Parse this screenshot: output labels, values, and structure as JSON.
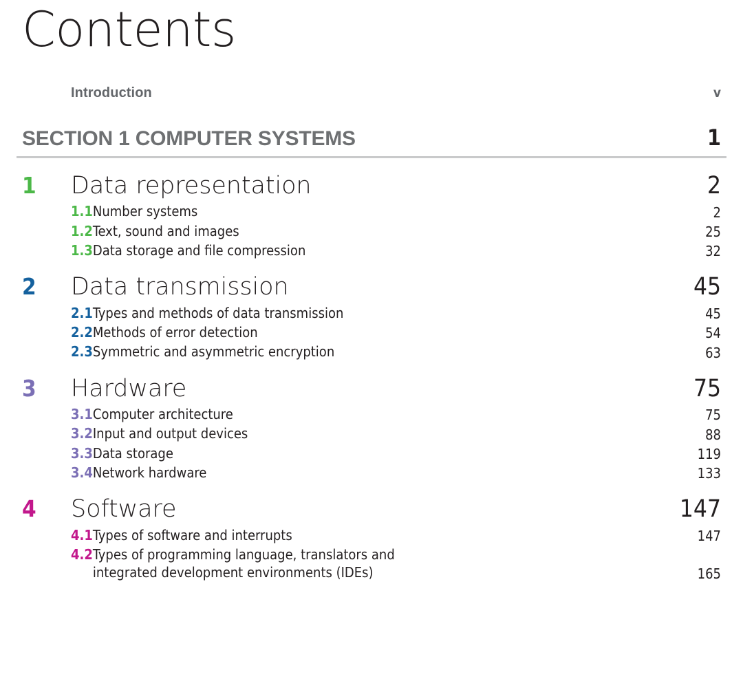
{
  "page_title": "Contents",
  "colors": {
    "text": "#231f20",
    "muted": "#63666a",
    "section_gray": "#6e7072",
    "rule": "#c9cacb",
    "chapter1_green": "#4cb848",
    "chapter2_blue": "#14619e",
    "chapter3_purple": "#7b6fb5",
    "chapter4_magenta": "#c2188c"
  },
  "frontmatter": [
    {
      "label": "Introduction",
      "page": "v"
    }
  ],
  "section": {
    "label": "SECTION 1 COMPUTER SYSTEMS",
    "page": "1"
  },
  "chapters": [
    {
      "number": "1",
      "title": "Data representation",
      "page": "2",
      "accent": "#4cb848",
      "subsections": [
        {
          "number": "1.1",
          "title": "Number systems",
          "page": "2"
        },
        {
          "number": "1.2",
          "title": "Text, sound and images",
          "page": "25"
        },
        {
          "number": "1.3",
          "title": "Data storage and file compression",
          "page": "32"
        }
      ]
    },
    {
      "number": "2",
      "title": "Data transmission",
      "page": "45",
      "accent": "#14619e",
      "subsections": [
        {
          "number": "2.1",
          "title": "Types and methods of data transmission",
          "page": "45"
        },
        {
          "number": "2.2",
          "title": "Methods of error detection",
          "page": "54"
        },
        {
          "number": "2.3",
          "title": "Symmetric and asymmetric encryption",
          "page": "63"
        }
      ]
    },
    {
      "number": "3",
      "title": "Hardware",
      "page": "75",
      "accent": "#7b6fb5",
      "subsections": [
        {
          "number": "3.1",
          "title": "Computer architecture",
          "page": "75"
        },
        {
          "number": "3.2",
          "title": "Input and output devices",
          "page": "88"
        },
        {
          "number": "3.3",
          "title": "Data storage",
          "page": "119"
        },
        {
          "number": "3.4",
          "title": "Network hardware",
          "page": "133"
        }
      ]
    },
    {
      "number": "4",
      "title": "Software",
      "page": "147",
      "accent": "#c2188c",
      "subsections": [
        {
          "number": "4.1",
          "title": "Types of software and interrupts",
          "page": "147"
        },
        {
          "number": "4.2",
          "title": "Types of programming language, translators and",
          "title_line2": "integrated development environments (IDEs)",
          "page": "165"
        }
      ]
    }
  ]
}
